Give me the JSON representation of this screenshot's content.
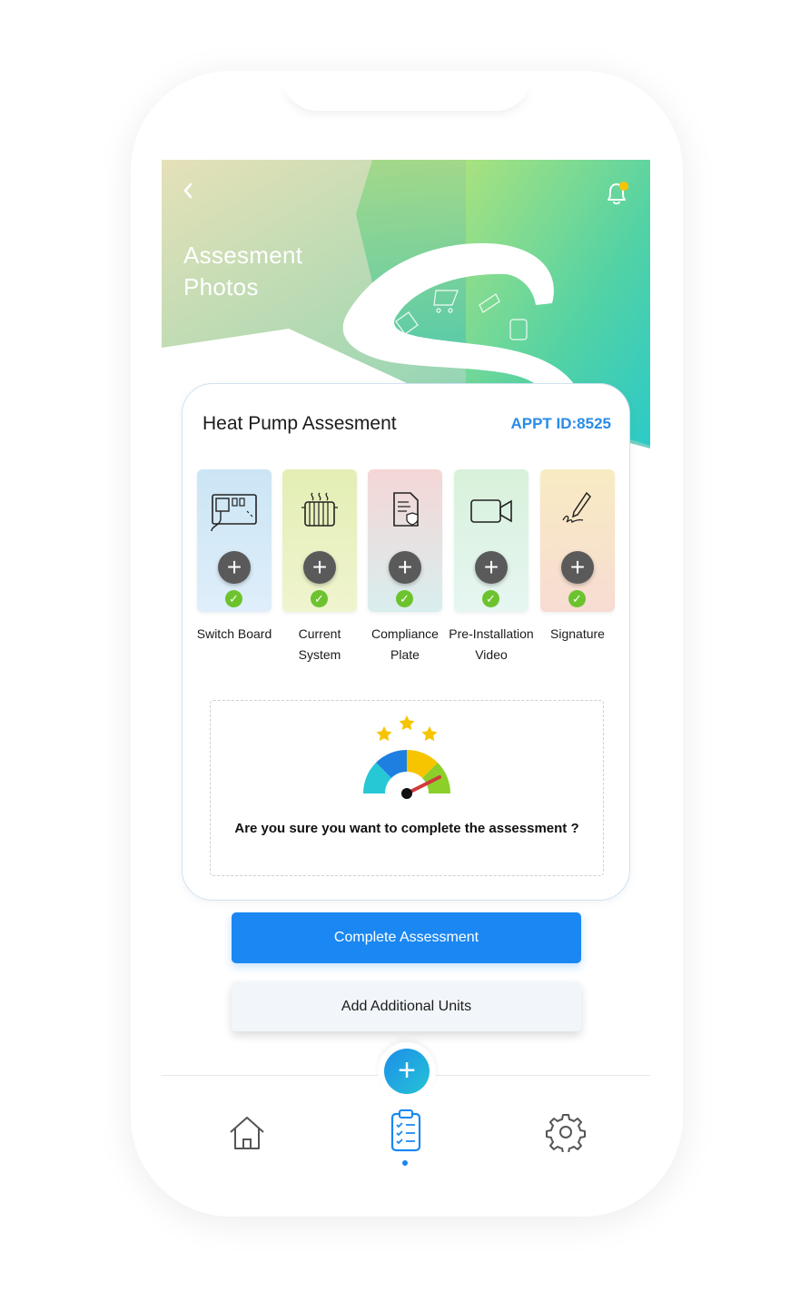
{
  "header": {
    "back_icon": "chevron-left-icon",
    "title": "Assesment Photos",
    "notification_icon": "bell-icon",
    "notification_badge_color": "#f7c400"
  },
  "card": {
    "title": "Heat Pump Assesment",
    "appointment_id": "APPT ID:8525",
    "tiles": [
      {
        "label": "Switch Board",
        "icon": "switchboard-icon",
        "status": "complete",
        "color": "#cde7f6"
      },
      {
        "label": "Current System",
        "icon": "radiator-icon",
        "status": "complete",
        "color": "#e7efb8"
      },
      {
        "label": "Compliance Plate",
        "icon": "document-shield-icon",
        "status": "complete",
        "color": "#f6d9d9"
      },
      {
        "label": "Pre-Installation Video",
        "icon": "video-camera-icon",
        "status": "complete",
        "color": "#dcf3e0"
      },
      {
        "label": "Signature",
        "icon": "pen-signature-icon",
        "status": "complete",
        "color": "#f8e9c3"
      }
    ],
    "confirm": {
      "icon": "gauge-rating-icon",
      "question": "Are you sure you want to complete the assessment ?"
    }
  },
  "actions": {
    "complete": "Complete Assessment",
    "add_units": "Add Additional Units"
  },
  "nav": {
    "fab_icon": "plus-icon",
    "items": [
      "home-icon",
      "clipboard-checklist-icon",
      "gear-icon"
    ],
    "active_index": 1,
    "accent": "#1a87f2"
  }
}
